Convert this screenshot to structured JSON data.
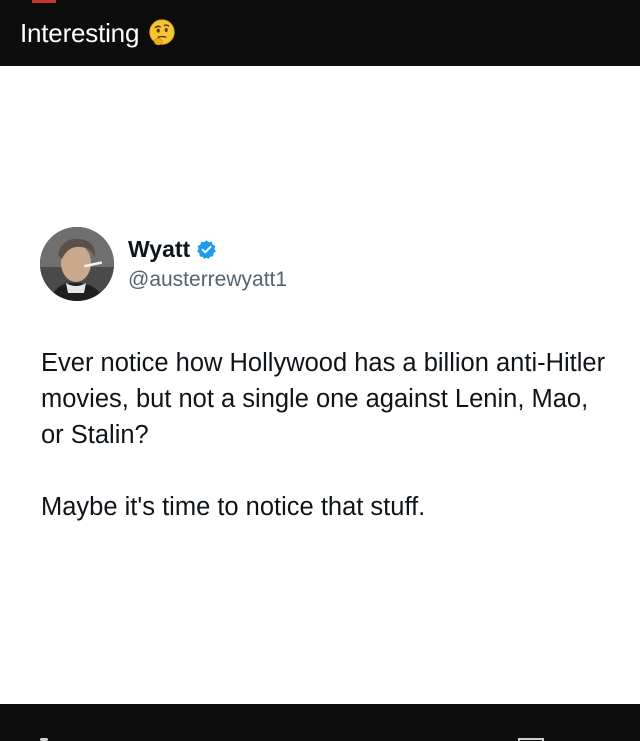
{
  "post": {
    "caption": "Interesting",
    "caption_emoji": "thinking-face-icon"
  },
  "tweet": {
    "author": {
      "display_name": "Wyatt",
      "handle": "@austerrewyatt1",
      "verified": true,
      "verified_color": "#1d9bf0"
    },
    "paragraphs": [
      "Ever notice how Hollywood has a billion anti-Hitler movies, but not a single one against Lenin, Mao, or Stalin?",
      "Maybe it's time to notice that stuff."
    ]
  },
  "colors": {
    "bar_background": "#0d0d0d",
    "card_background": "#ffffff",
    "text_primary": "#0f1419",
    "text_secondary": "#536471"
  }
}
